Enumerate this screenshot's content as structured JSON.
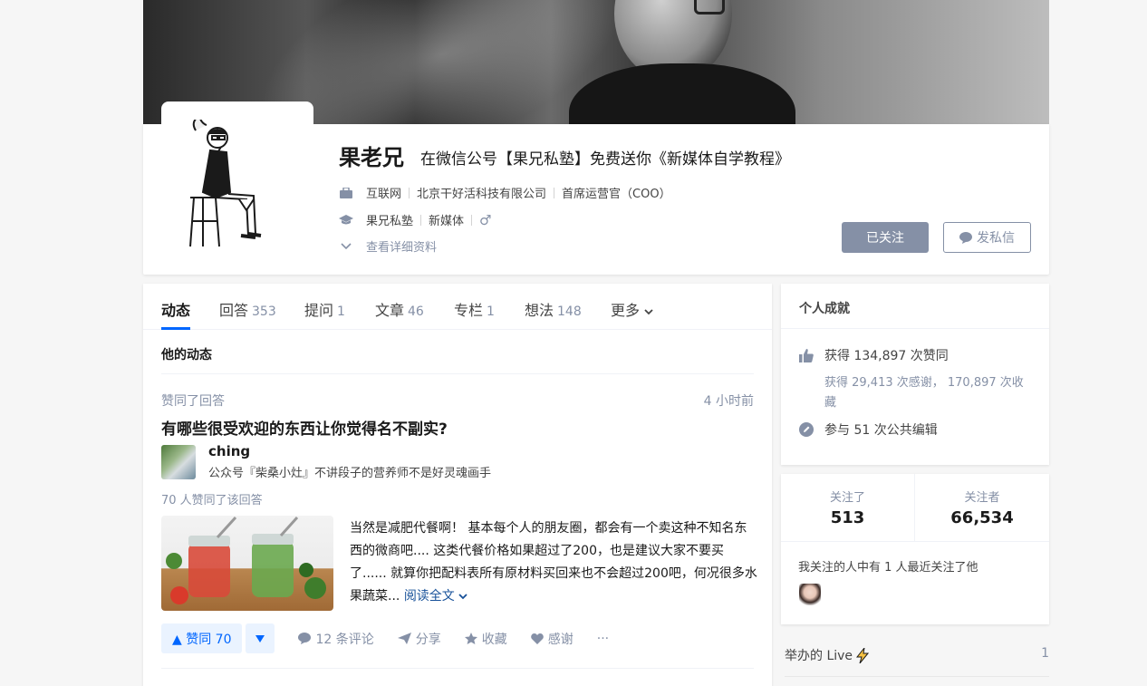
{
  "profile": {
    "name": "果老兄",
    "headline": "在微信公号【果兄私塾】免费送你《新媒体自学教程》",
    "industry": "互联网",
    "company": "北京干好活科技有限公司",
    "position": "首席运营官（COO）",
    "school": "果兄私塾",
    "major": "新媒体",
    "gender_symbol": "♂",
    "details_link": "查看详细资料",
    "followed_label": "已关注",
    "message_label": "发私信"
  },
  "tabs": [
    {
      "label": "动态",
      "count": ""
    },
    {
      "label": "回答",
      "count": "353"
    },
    {
      "label": "提问",
      "count": "1"
    },
    {
      "label": "文章",
      "count": "46"
    },
    {
      "label": "专栏",
      "count": "1"
    },
    {
      "label": "想法",
      "count": "148"
    },
    {
      "label": "更多",
      "count": ""
    }
  ],
  "feed": {
    "section_title": "他的动态",
    "item": {
      "action": "赞同了回答",
      "time": "4 小时前",
      "question": "有哪些很受欢迎的东西让你觉得名不副实?",
      "author_name": "ching",
      "author_bio": "公众号『柴桑小灶』不讲段子的营养师不是好灵魂画手",
      "voters": "70 人赞同了该回答",
      "excerpt": "当然是减肥代餐啊！ 基本每个人的朋友圈，都会有一个卖这种不知名东西的微商吧.... 这类代餐价格如果超过了200，也是建议大家不要买了...... 就算你把配料表所有原材料买回来也不会超过200吧，何况很多水果蔬菜...",
      "read_more": "阅读全文",
      "vote_label": "▲ 赞同 70",
      "comments": "12 条评论",
      "share": "分享",
      "collect": "收藏",
      "thanks": "感谢",
      "more": "···"
    }
  },
  "achievements": {
    "title": "个人成就",
    "likes": "获得 134,897 次赞同",
    "sub": "获得 29,413 次感谢， 170,897 次收藏",
    "edits": "参与 51 次公共编辑"
  },
  "follow": {
    "following_label": "关注了",
    "following_count": "513",
    "followers_label": "关注者",
    "followers_count": "66,534",
    "mutual": "我关注的人中有 1 人最近关注了他"
  },
  "live": {
    "label": "举办的 Live",
    "count": "1"
  },
  "colors": {
    "accent": "#0066ff",
    "muted": "#8590a6",
    "link": "#175199"
  }
}
